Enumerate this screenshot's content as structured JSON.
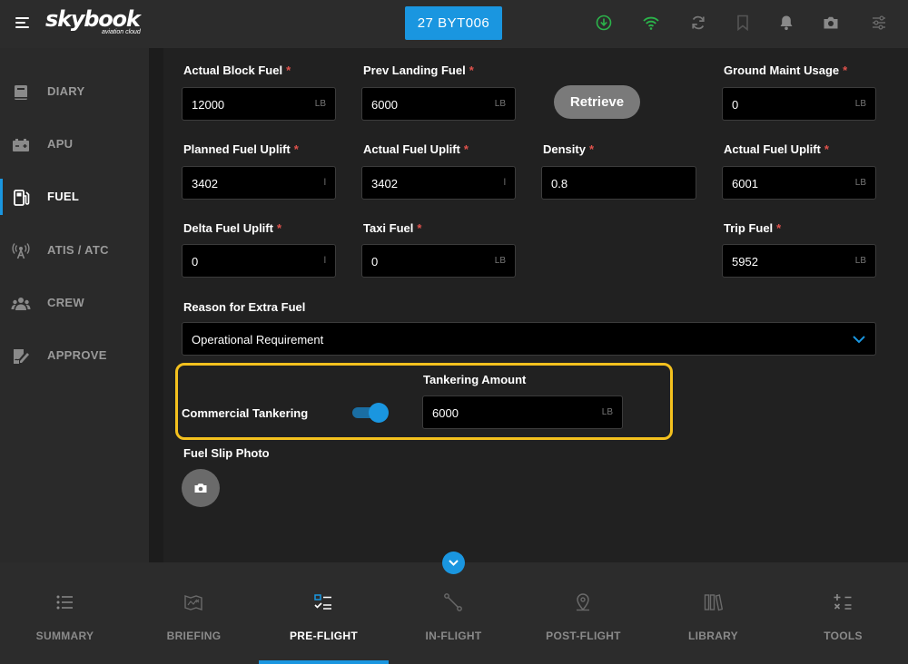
{
  "app": {
    "logo": "skybook",
    "logo_subtitle": "aviation cloud",
    "flight_id": "27 BYT006"
  },
  "colors": {
    "accent": "#1a96e0",
    "required": "#e0524c",
    "highlight": "#f4c11e",
    "download_icon": "#2bb34a",
    "wifi_icon": "#2bb34a"
  },
  "topbar_icons": [
    "download-icon",
    "wifi-icon",
    "sync-icon",
    "bookmark-icon",
    "bell-icon",
    "camera-icon",
    "settings-sliders-icon"
  ],
  "sidebar": {
    "items": [
      {
        "label": "DIARY",
        "icon": "book-icon"
      },
      {
        "label": "APU",
        "icon": "battery-icon"
      },
      {
        "label": "FUEL",
        "icon": "fuel-pump-icon",
        "active": true
      },
      {
        "label": "ATIS / ATC",
        "icon": "antenna-icon"
      },
      {
        "label": "CREW",
        "icon": "people-icon"
      },
      {
        "label": "APPROVE",
        "icon": "sign-document-icon"
      }
    ]
  },
  "form": {
    "required_mark": "*",
    "actual_block_fuel": {
      "label": "Actual Block Fuel",
      "value": "12000",
      "unit": "LB"
    },
    "prev_landing_fuel": {
      "label": "Prev Landing Fuel",
      "value": "6000",
      "unit": "LB"
    },
    "retrieve_label": "Retrieve",
    "ground_maint_usage": {
      "label": "Ground Maint Usage",
      "value": "0",
      "unit": "LB"
    },
    "planned_fuel_uplift": {
      "label": "Planned Fuel Uplift",
      "value": "3402",
      "unit": "l"
    },
    "actual_fuel_uplift_l": {
      "label": "Actual Fuel Uplift",
      "value": "3402",
      "unit": "l"
    },
    "density": {
      "label": "Density",
      "value": "0.8"
    },
    "actual_fuel_uplift_lb": {
      "label": "Actual Fuel Uplift",
      "value": "6001",
      "unit": "LB"
    },
    "delta_fuel_uplift": {
      "label": "Delta Fuel Uplift",
      "value": "0",
      "unit": "l"
    },
    "taxi_fuel": {
      "label": "Taxi Fuel",
      "value": "0",
      "unit": "LB"
    },
    "trip_fuel": {
      "label": "Trip Fuel",
      "value": "5952",
      "unit": "LB"
    },
    "reason_extra_fuel": {
      "label": "Reason for Extra Fuel",
      "value": "Operational Requirement"
    },
    "commercial_tankering": {
      "label": "Commercial Tankering",
      "enabled": true
    },
    "tankering_amount": {
      "label": "Tankering Amount",
      "value": "6000",
      "unit": "LB"
    },
    "fuel_slip_photo": {
      "label": "Fuel Slip Photo"
    }
  },
  "bottom_tabs": [
    {
      "label": "SUMMARY",
      "icon": "list-icon"
    },
    {
      "label": "BRIEFING",
      "icon": "map-route-icon"
    },
    {
      "label": "PRE-FLIGHT",
      "icon": "checklist-icon",
      "active": true
    },
    {
      "label": "IN-FLIGHT",
      "icon": "route-nodes-icon"
    },
    {
      "label": "POST-FLIGHT",
      "icon": "location-pin-icon"
    },
    {
      "label": "LIBRARY",
      "icon": "books-icon"
    },
    {
      "label": "TOOLS",
      "icon": "calculator-icon"
    }
  ]
}
